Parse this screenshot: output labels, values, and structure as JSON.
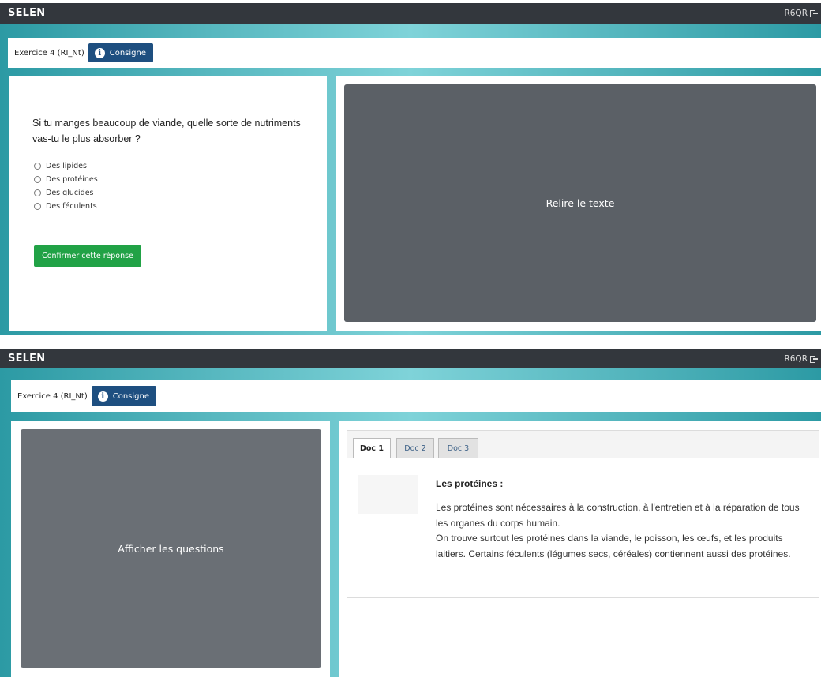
{
  "app": {
    "brand": "SELEN",
    "user_code": "R6QR"
  },
  "exercise": {
    "title": "Exercice 4 (RI_Nt)",
    "consigne_label": "Consigne"
  },
  "quiz": {
    "question": "Si tu manges beaucoup de viande, quelle sorte de nutriments vas-tu le plus absorber ?",
    "options": [
      "Des lipides",
      "Des protéines",
      "Des glucides",
      "Des féculents"
    ],
    "confirm_label": "Confirmer cette réponse",
    "reread_label": "Relire le texte"
  },
  "reading": {
    "show_questions_label": "Afficher les questions",
    "tabs": [
      "Doc 1",
      "Doc 2",
      "Doc 3"
    ],
    "active_tab": "Doc 1",
    "doc_title": "Les protéines :",
    "doc_paragraph_1": "Les protéines sont nécessaires à la construction, à l'entretien et à la réparation de tous les organes du corps humain.",
    "doc_paragraph_2": "On trouve surtout les protéines dans la viande, le poisson, les œufs, et les produits laitiers. Certains féculents (légumes secs, céréales) contiennent aussi des protéines."
  },
  "colors": {
    "topbar": "#33373d",
    "teal_dark": "#2c9aa4",
    "teal_light": "#7fd3d9",
    "consigne_button": "#1e4f80",
    "confirm_button": "#21a246",
    "grey_panel": "#5b6066"
  },
  "icons": {
    "consigne": "info-icon",
    "logout": "logout-icon"
  }
}
